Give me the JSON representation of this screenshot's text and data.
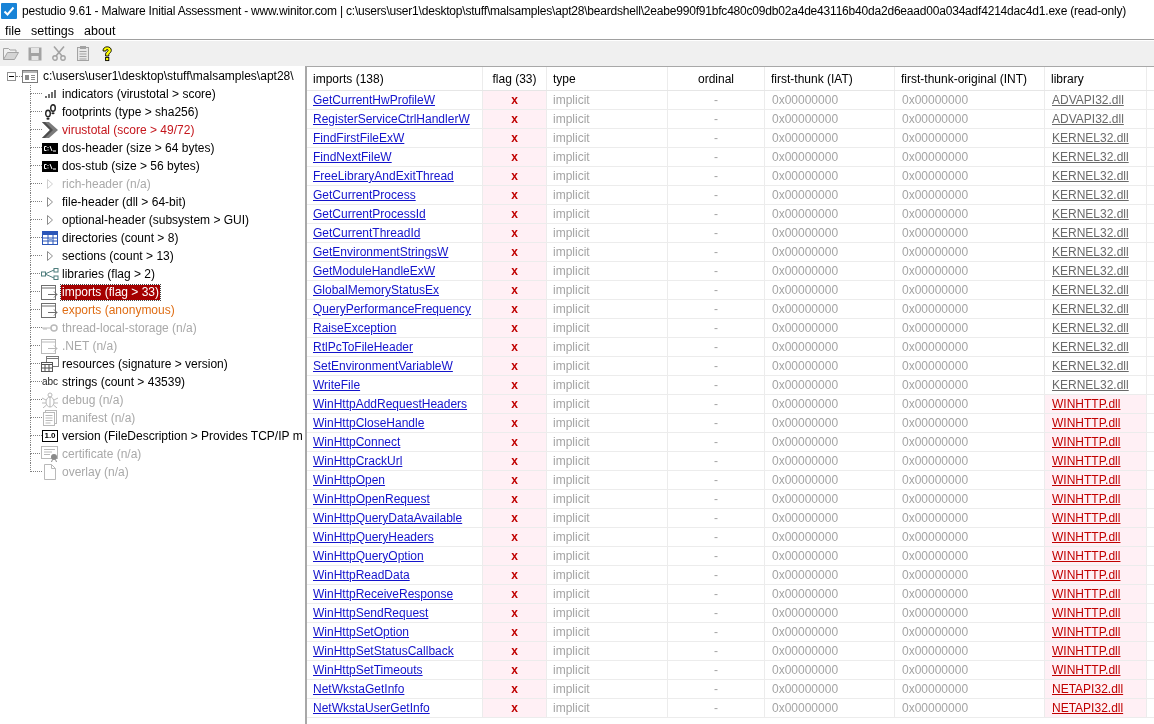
{
  "title_bar": {
    "title": "pestudio 9.61 - Malware Initial Assessment - www.winitor.com | c:\\users\\user1\\desktop\\stuff\\malsamples\\apt28\\beardshell\\2eabe990f91bfc480c09db02a4de43116b40da2d6eaad00a034adf4214dac4d1.exe (read-only)"
  },
  "menu": [
    "file",
    "settings",
    "about"
  ],
  "toolbar": [
    {
      "kind": "open",
      "disabled": true
    },
    {
      "kind": "save",
      "disabled": true
    },
    {
      "kind": "cut",
      "disabled": true
    },
    {
      "kind": "clipboard",
      "disabled": true
    },
    {
      "kind": "help",
      "disabled": false
    }
  ],
  "tree": {
    "label": "c:\\users\\user1\\desktop\\stuff\\malsamples\\apt28\\",
    "kind": "window",
    "expanded": true,
    "children": [
      {
        "label": "indicators (virustotal > score)",
        "kind": "bars",
        "color": "#000000",
        "disabled": false,
        "selected": false
      },
      {
        "label": "footprints (type > sha256)",
        "kind": "footprints",
        "color": "#000000",
        "disabled": false,
        "selected": false
      },
      {
        "label": "virustotal (score > 49/72)",
        "kind": "chevron",
        "color": "#c4161c",
        "disabled": false,
        "selected": false
      },
      {
        "label": "dos-header (size > 64 bytes)",
        "kind": "console",
        "color": "#000000",
        "disabled": false,
        "selected": false
      },
      {
        "label": "dos-stub (size > 56 bytes)",
        "kind": "console",
        "color": "#000000",
        "disabled": false,
        "selected": false
      },
      {
        "label": "rich-header (n/a)",
        "kind": "triangle",
        "color": "#a9a9a9",
        "disabled": true,
        "selected": false
      },
      {
        "label": "file-header (dll > 64-bit)",
        "kind": "triangle",
        "color": "#000000",
        "disabled": false,
        "selected": false
      },
      {
        "label": "optional-header (subsystem > GUI)",
        "kind": "triangle",
        "color": "#000000",
        "disabled": false,
        "selected": false
      },
      {
        "label": "directories (count > 8)",
        "kind": "table",
        "color": "#000000",
        "disabled": false,
        "selected": false
      },
      {
        "label": "sections (count > 13)",
        "kind": "triangle",
        "color": "#000000",
        "disabled": false,
        "selected": false
      },
      {
        "label": "libraries (flag > 2)",
        "kind": "network",
        "color": "#000000",
        "disabled": false,
        "selected": false
      },
      {
        "label": "imports (flag > 33)",
        "kind": "window-arrow",
        "disabled": false,
        "selected": true
      },
      {
        "label": "exports (anonymous)",
        "kind": "window-arrow",
        "color": "#df6d14",
        "disabled": false,
        "selected": false
      },
      {
        "label": "thread-local-storage (n/a)",
        "kind": "key",
        "color": "#a9a9a9",
        "disabled": true,
        "selected": false
      },
      {
        "label": ".NET (n/a)",
        "kind": "window-arrow",
        "color": "#a9a9a9",
        "disabled": true,
        "selected": false
      },
      {
        "label": "resources (signature > version)",
        "kind": "resources",
        "color": "#000000",
        "disabled": false,
        "selected": false
      },
      {
        "label": "strings (count > 43539)",
        "kind": "text",
        "icon_text": "abc",
        "color": "#000000",
        "disabled": false,
        "selected": false
      },
      {
        "label": "debug (n/a)",
        "kind": "bug",
        "color": "#a9a9a9",
        "disabled": true,
        "selected": false
      },
      {
        "label": "manifest (n/a)",
        "kind": "document",
        "color": "#a9a9a9",
        "disabled": true,
        "selected": false
      },
      {
        "label": "version (FileDescription > Provides TCP/IP m",
        "kind": "boxed-text",
        "icon_text": "1.0",
        "color": "#000000",
        "disabled": false,
        "selected": false
      },
      {
        "label": "certificate (n/a)",
        "kind": "certificate",
        "color": "#a9a9a9",
        "disabled": true,
        "selected": false
      },
      {
        "label": "overlay (n/a)",
        "kind": "page",
        "color": "#a9a9a9",
        "disabled": true,
        "selected": false
      }
    ]
  },
  "imports": {
    "columns": [
      "imports (138)",
      "flag (33)",
      "type",
      "ordinal",
      "first-thunk (IAT)",
      "first-thunk-original (INT)",
      "library"
    ],
    "rows": [
      {
        "name": "GetCurrentHwProfileW",
        "flag": "x",
        "type": "implicit",
        "ordinal": "-",
        "first_thunk": "0x00000000",
        "first_thunk_original": "0x00000000",
        "library": "ADVAPI32.dll",
        "library_flagged": false
      },
      {
        "name": "RegisterServiceCtrlHandlerW",
        "flag": "x",
        "type": "implicit",
        "ordinal": "-",
        "first_thunk": "0x00000000",
        "first_thunk_original": "0x00000000",
        "library": "ADVAPI32.dll",
        "library_flagged": false
      },
      {
        "name": "FindFirstFileExW",
        "flag": "x",
        "type": "implicit",
        "ordinal": "-",
        "first_thunk": "0x00000000",
        "first_thunk_original": "0x00000000",
        "library": "KERNEL32.dll",
        "library_flagged": false
      },
      {
        "name": "FindNextFileW",
        "flag": "x",
        "type": "implicit",
        "ordinal": "-",
        "first_thunk": "0x00000000",
        "first_thunk_original": "0x00000000",
        "library": "KERNEL32.dll",
        "library_flagged": false
      },
      {
        "name": "FreeLibraryAndExitThread",
        "flag": "x",
        "type": "implicit",
        "ordinal": "-",
        "first_thunk": "0x00000000",
        "first_thunk_original": "0x00000000",
        "library": "KERNEL32.dll",
        "library_flagged": false
      },
      {
        "name": "GetCurrentProcess",
        "flag": "x",
        "type": "implicit",
        "ordinal": "-",
        "first_thunk": "0x00000000",
        "first_thunk_original": "0x00000000",
        "library": "KERNEL32.dll",
        "library_flagged": false
      },
      {
        "name": "GetCurrentProcessId",
        "flag": "x",
        "type": "implicit",
        "ordinal": "-",
        "first_thunk": "0x00000000",
        "first_thunk_original": "0x00000000",
        "library": "KERNEL32.dll",
        "library_flagged": false
      },
      {
        "name": "GetCurrentThreadId",
        "flag": "x",
        "type": "implicit",
        "ordinal": "-",
        "first_thunk": "0x00000000",
        "first_thunk_original": "0x00000000",
        "library": "KERNEL32.dll",
        "library_flagged": false
      },
      {
        "name": "GetEnvironmentStringsW",
        "flag": "x",
        "type": "implicit",
        "ordinal": "-",
        "first_thunk": "0x00000000",
        "first_thunk_original": "0x00000000",
        "library": "KERNEL32.dll",
        "library_flagged": false
      },
      {
        "name": "GetModuleHandleExW",
        "flag": "x",
        "type": "implicit",
        "ordinal": "-",
        "first_thunk": "0x00000000",
        "first_thunk_original": "0x00000000",
        "library": "KERNEL32.dll",
        "library_flagged": false
      },
      {
        "name": "GlobalMemoryStatusEx",
        "flag": "x",
        "type": "implicit",
        "ordinal": "-",
        "first_thunk": "0x00000000",
        "first_thunk_original": "0x00000000",
        "library": "KERNEL32.dll",
        "library_flagged": false
      },
      {
        "name": "QueryPerformanceFrequency",
        "flag": "x",
        "type": "implicit",
        "ordinal": "-",
        "first_thunk": "0x00000000",
        "first_thunk_original": "0x00000000",
        "library": "KERNEL32.dll",
        "library_flagged": false
      },
      {
        "name": "RaiseException",
        "flag": "x",
        "type": "implicit",
        "ordinal": "-",
        "first_thunk": "0x00000000",
        "first_thunk_original": "0x00000000",
        "library": "KERNEL32.dll",
        "library_flagged": false
      },
      {
        "name": "RtlPcToFileHeader",
        "flag": "x",
        "type": "implicit",
        "ordinal": "-",
        "first_thunk": "0x00000000",
        "first_thunk_original": "0x00000000",
        "library": "KERNEL32.dll",
        "library_flagged": false
      },
      {
        "name": "SetEnvironmentVariableW",
        "flag": "x",
        "type": "implicit",
        "ordinal": "-",
        "first_thunk": "0x00000000",
        "first_thunk_original": "0x00000000",
        "library": "KERNEL32.dll",
        "library_flagged": false
      },
      {
        "name": "WriteFile",
        "flag": "x",
        "type": "implicit",
        "ordinal": "-",
        "first_thunk": "0x00000000",
        "first_thunk_original": "0x00000000",
        "library": "KERNEL32.dll",
        "library_flagged": false
      },
      {
        "name": "WinHttpAddRequestHeaders",
        "flag": "x",
        "type": "implicit",
        "ordinal": "-",
        "first_thunk": "0x00000000",
        "first_thunk_original": "0x00000000",
        "library": "WINHTTP.dll",
        "library_flagged": true
      },
      {
        "name": "WinHttpCloseHandle",
        "flag": "x",
        "type": "implicit",
        "ordinal": "-",
        "first_thunk": "0x00000000",
        "first_thunk_original": "0x00000000",
        "library": "WINHTTP.dll",
        "library_flagged": true
      },
      {
        "name": "WinHttpConnect",
        "flag": "x",
        "type": "implicit",
        "ordinal": "-",
        "first_thunk": "0x00000000",
        "first_thunk_original": "0x00000000",
        "library": "WINHTTP.dll",
        "library_flagged": true
      },
      {
        "name": "WinHttpCrackUrl",
        "flag": "x",
        "type": "implicit",
        "ordinal": "-",
        "first_thunk": "0x00000000",
        "first_thunk_original": "0x00000000",
        "library": "WINHTTP.dll",
        "library_flagged": true
      },
      {
        "name": "WinHttpOpen",
        "flag": "x",
        "type": "implicit",
        "ordinal": "-",
        "first_thunk": "0x00000000",
        "first_thunk_original": "0x00000000",
        "library": "WINHTTP.dll",
        "library_flagged": true
      },
      {
        "name": "WinHttpOpenRequest",
        "flag": "x",
        "type": "implicit",
        "ordinal": "-",
        "first_thunk": "0x00000000",
        "first_thunk_original": "0x00000000",
        "library": "WINHTTP.dll",
        "library_flagged": true
      },
      {
        "name": "WinHttpQueryDataAvailable",
        "flag": "x",
        "type": "implicit",
        "ordinal": "-",
        "first_thunk": "0x00000000",
        "first_thunk_original": "0x00000000",
        "library": "WINHTTP.dll",
        "library_flagged": true
      },
      {
        "name": "WinHttpQueryHeaders",
        "flag": "x",
        "type": "implicit",
        "ordinal": "-",
        "first_thunk": "0x00000000",
        "first_thunk_original": "0x00000000",
        "library": "WINHTTP.dll",
        "library_flagged": true
      },
      {
        "name": "WinHttpQueryOption",
        "flag": "x",
        "type": "implicit",
        "ordinal": "-",
        "first_thunk": "0x00000000",
        "first_thunk_original": "0x00000000",
        "library": "WINHTTP.dll",
        "library_flagged": true
      },
      {
        "name": "WinHttpReadData",
        "flag": "x",
        "type": "implicit",
        "ordinal": "-",
        "first_thunk": "0x00000000",
        "first_thunk_original": "0x00000000",
        "library": "WINHTTP.dll",
        "library_flagged": true
      },
      {
        "name": "WinHttpReceiveResponse",
        "flag": "x",
        "type": "implicit",
        "ordinal": "-",
        "first_thunk": "0x00000000",
        "first_thunk_original": "0x00000000",
        "library": "WINHTTP.dll",
        "library_flagged": true
      },
      {
        "name": "WinHttpSendRequest",
        "flag": "x",
        "type": "implicit",
        "ordinal": "-",
        "first_thunk": "0x00000000",
        "first_thunk_original": "0x00000000",
        "library": "WINHTTP.dll",
        "library_flagged": true
      },
      {
        "name": "WinHttpSetOption",
        "flag": "x",
        "type": "implicit",
        "ordinal": "-",
        "first_thunk": "0x00000000",
        "first_thunk_original": "0x00000000",
        "library": "WINHTTP.dll",
        "library_flagged": true
      },
      {
        "name": "WinHttpSetStatusCallback",
        "flag": "x",
        "type": "implicit",
        "ordinal": "-",
        "first_thunk": "0x00000000",
        "first_thunk_original": "0x00000000",
        "library": "WINHTTP.dll",
        "library_flagged": true
      },
      {
        "name": "WinHttpSetTimeouts",
        "flag": "x",
        "type": "implicit",
        "ordinal": "-",
        "first_thunk": "0x00000000",
        "first_thunk_original": "0x00000000",
        "library": "WINHTTP.dll",
        "library_flagged": true
      },
      {
        "name": "NetWkstaGetInfo",
        "flag": "x",
        "type": "implicit",
        "ordinal": "-",
        "first_thunk": "0x00000000",
        "first_thunk_original": "0x00000000",
        "library": "NETAPI32.dll",
        "library_flagged": true
      },
      {
        "name": "NetWkstaUserGetInfo",
        "flag": "x",
        "type": "implicit",
        "ordinal": "-",
        "first_thunk": "0x00000000",
        "first_thunk_original": "0x00000000",
        "library": "NETAPI32.dll",
        "library_flagged": true
      }
    ]
  }
}
